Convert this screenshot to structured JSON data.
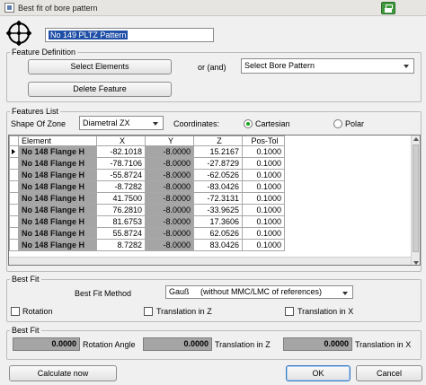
{
  "window": {
    "title": "Best fit of bore pattern"
  },
  "pattern_name": "No 149 PLTZ Pattern",
  "feature_definition": {
    "title": "Feature Definition",
    "select_elements_label": "Select Elements",
    "or_label": "or (and)",
    "bore_pattern_value": "Select Bore Pattern",
    "delete_feature_label": "Delete Feature"
  },
  "features_list": {
    "title": "Features List",
    "shape_of_zone_label": "Shape Of Zone",
    "shape_of_zone_value": "Diametral ZX",
    "coordinates_label": "Coordinates:",
    "cartesian_label": "Cartesian",
    "polar_label": "Polar",
    "columns": [
      "Element",
      "X",
      "Y",
      "Z",
      "Pos-Tol"
    ],
    "rows": [
      {
        "element": "No 148 Flange H",
        "x": "-82.1018",
        "y": "-8.0000",
        "z": "15.2167",
        "tol": "0.1000"
      },
      {
        "element": "No 148 Flange H",
        "x": "-78.7106",
        "y": "-8.0000",
        "z": "-27.8729",
        "tol": "0.1000"
      },
      {
        "element": "No 148 Flange H",
        "x": "-55.8724",
        "y": "-8.0000",
        "z": "-62.0526",
        "tol": "0.1000"
      },
      {
        "element": "No 148 Flange H",
        "x": "-8.7282",
        "y": "-8.0000",
        "z": "-83.0426",
        "tol": "0.1000"
      },
      {
        "element": "No 148 Flange H",
        "x": "41.7500",
        "y": "-8.0000",
        "z": "-72.3131",
        "tol": "0.1000"
      },
      {
        "element": "No 148 Flange H",
        "x": "76.2810",
        "y": "-8.0000",
        "z": "-33.9625",
        "tol": "0.1000"
      },
      {
        "element": "No 148 Flange H",
        "x": "81.6753",
        "y": "-8.0000",
        "z": "17.3606",
        "tol": "0.1000"
      },
      {
        "element": "No 148 Flange H",
        "x": "55.8724",
        "y": "-8.0000",
        "z": "62.0526",
        "tol": "0.1000"
      },
      {
        "element": "No 148 Flange H",
        "x": "8.7282",
        "y": "-8.0000",
        "z": "83.0426",
        "tol": "0.1000"
      }
    ]
  },
  "best_fit_method": {
    "title": "Best Fit",
    "method_label": "Best Fit Method",
    "method_value": "Gauß     (without MMC/LMC of references)",
    "rotation_label": "Rotation",
    "translation_z_label": "Translation in Z",
    "translation_x_label": "Translation in X"
  },
  "best_fit_results": {
    "title": "Best Fit",
    "rotation_value": "0.0000",
    "rotation_label": "Rotation Angle",
    "translation_z_value": "0.0000",
    "translation_z_label": "Translation in Z",
    "translation_x_value": "0.0000",
    "translation_x_label": "Translation in X"
  },
  "footer": {
    "calculate_label": "Calculate now",
    "ok_label": "OK",
    "cancel_label": "Cancel"
  }
}
